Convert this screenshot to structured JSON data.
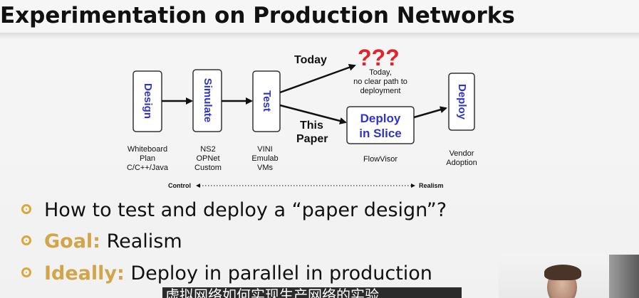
{
  "slide": {
    "title": "Experimentation on Production Networks"
  },
  "diagram": {
    "stages": [
      {
        "label": "Design",
        "sublabels": [
          "Whiteboard",
          "Plan",
          "C/C++/Java"
        ]
      },
      {
        "label": "Simulate",
        "sublabels": [
          "NS2",
          "OPNet",
          "Custom"
        ]
      },
      {
        "label": "Test",
        "sublabels": [
          "VINI",
          "Emulab",
          "VMs"
        ]
      }
    ],
    "today_label": "Today",
    "question_marks": "???",
    "today_note": [
      "Today,",
      "no clear path to",
      "deployment"
    ],
    "this_paper_label": [
      "This",
      "Paper"
    ],
    "deploy_slice_label": [
      "Deploy",
      "in Slice"
    ],
    "flowvisor_label": "FlowVisor",
    "deploy_label": "Deploy",
    "deploy_sublabels": [
      "Vendor",
      "Adoption"
    ],
    "axis_left": "Control",
    "axis_right": "Realism",
    "colors": {
      "box_text": "#2e34c9",
      "question": "#e0242a",
      "arrow": "#111111"
    }
  },
  "bullets": [
    {
      "keyword": "",
      "text": "How to test and deploy a “paper design”?"
    },
    {
      "keyword": "Goal:",
      "text": " Realism"
    },
    {
      "keyword": "Ideally:",
      "text": " Deploy in parallel in production"
    }
  ],
  "video": {
    "subtitle": "虚拟网络如何实现生产网络的实验"
  }
}
